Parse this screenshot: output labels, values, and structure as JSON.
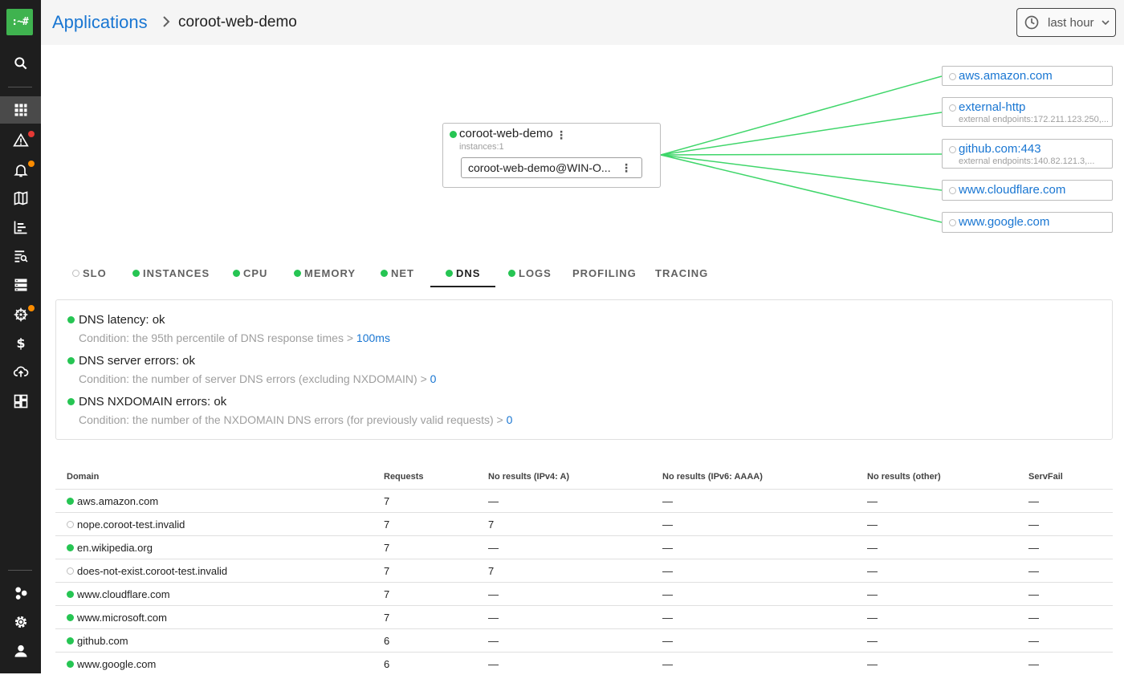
{
  "sidebar": {
    "logo": ":~#",
    "icons": [
      "search-icon",
      "applications-icon",
      "incidents-icon",
      "alerts-icon",
      "service-map-icon",
      "traces-icon",
      "logs-icon",
      "nodes-icon",
      "kubernetes-icon",
      "costs-icon",
      "cloud-upload-icon",
      "dashboards-icon",
      "integrations-icon",
      "settings-icon",
      "user-icon"
    ],
    "badges": {
      "incidents": "#e53935",
      "alerts": "#fb8c00",
      "kubernetes": "#fb8c00"
    }
  },
  "header": {
    "breadcrumb_root": "Applications",
    "breadcrumb_current": "coroot-web-demo",
    "time_range": "last hour"
  },
  "map": {
    "app": {
      "name": "coroot-web-demo",
      "instances_label": "instances:1",
      "instance": "coroot-web-demo@WIN-O..."
    },
    "dependencies": [
      {
        "name": "aws.amazon.com",
        "sub": ""
      },
      {
        "name": "external-http",
        "sub": "external endpoints:172.211.123.250,..."
      },
      {
        "name": "github.com:443",
        "sub": "external endpoints:140.82.121.3,..."
      },
      {
        "name": "www.cloudflare.com",
        "sub": ""
      },
      {
        "name": "www.google.com",
        "sub": ""
      }
    ],
    "link_color": "#3fd66a"
  },
  "tabs": [
    {
      "label": "SLO",
      "status": "empty"
    },
    {
      "label": "INSTANCES",
      "status": "ok"
    },
    {
      "label": "CPU",
      "status": "ok"
    },
    {
      "label": "MEMORY",
      "status": "ok"
    },
    {
      "label": "NET",
      "status": "ok"
    },
    {
      "label": "DNS",
      "status": "ok",
      "active": true
    },
    {
      "label": "LOGS",
      "status": "ok"
    },
    {
      "label": "PROFILING",
      "status": "none"
    },
    {
      "label": "TRACING",
      "status": "none"
    }
  ],
  "checks": [
    {
      "title": "DNS latency: ok",
      "condition": "Condition: the 95th percentile of DNS response times > ",
      "value": "100ms"
    },
    {
      "title": "DNS server errors: ok",
      "condition": "Condition: the number of server DNS errors (excluding NXDOMAIN) > ",
      "value": "0"
    },
    {
      "title": "DNS NXDOMAIN errors: ok",
      "condition": "Condition: the number of the NXDOMAIN DNS errors (for previously valid requests) > ",
      "value": "0"
    }
  ],
  "table": {
    "headers": [
      "Domain",
      "Requests",
      "No results (IPv4: A)",
      "No results (IPv6: AAAA)",
      "No results (other)",
      "ServFail"
    ],
    "rows": [
      {
        "status": "ok",
        "cells": [
          "aws.amazon.com",
          "7",
          "—",
          "—",
          "—",
          "—"
        ]
      },
      {
        "status": "empty",
        "cells": [
          "nope.coroot-test.invalid",
          "7",
          "7",
          "—",
          "—",
          "—"
        ]
      },
      {
        "status": "ok",
        "cells": [
          "en.wikipedia.org",
          "7",
          "—",
          "—",
          "—",
          "—"
        ]
      },
      {
        "status": "empty",
        "cells": [
          "does-not-exist.coroot-test.invalid",
          "7",
          "7",
          "—",
          "—",
          "—"
        ]
      },
      {
        "status": "ok",
        "cells": [
          "www.cloudflare.com",
          "7",
          "—",
          "—",
          "—",
          "—"
        ]
      },
      {
        "status": "ok",
        "cells": [
          "www.microsoft.com",
          "7",
          "—",
          "—",
          "—",
          "—"
        ]
      },
      {
        "status": "ok",
        "cells": [
          "github.com",
          "6",
          "—",
          "—",
          "—",
          "—"
        ]
      },
      {
        "status": "ok",
        "cells": [
          "www.google.com",
          "6",
          "—",
          "—",
          "—",
          "—"
        ]
      }
    ]
  }
}
